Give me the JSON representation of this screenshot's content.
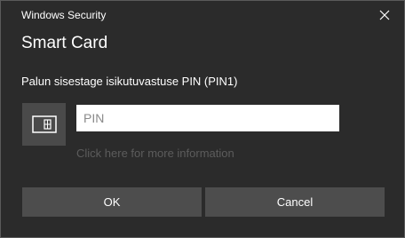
{
  "window": {
    "title": "Windows Security"
  },
  "dialog": {
    "heading": "Smart Card",
    "prompt": "Palun sisestage isikutuvastuse PIN (PIN1)",
    "pin_field": {
      "value": "",
      "placeholder": "PIN"
    },
    "more_info_link": "Click here for more information",
    "card_icon": "smart-card-icon"
  },
  "buttons": {
    "ok": "OK",
    "cancel": "Cancel"
  },
  "icons": {
    "close": "close-icon"
  },
  "colors": {
    "background": "#2b2b2b",
    "button": "#4d4d4d",
    "icon_box": "#4a4a4a",
    "link": "#5c5c5c"
  }
}
